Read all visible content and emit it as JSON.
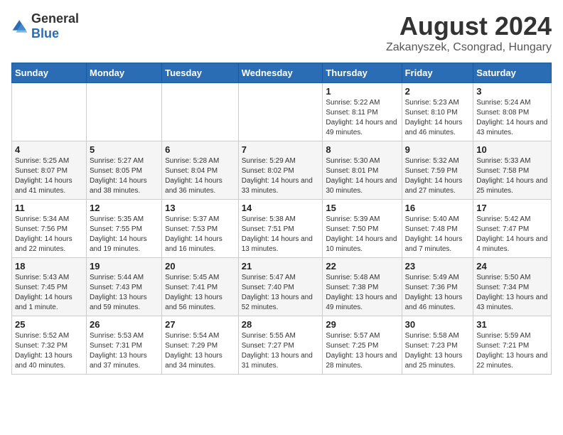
{
  "header": {
    "logo_general": "General",
    "logo_blue": "Blue",
    "title": "August 2024",
    "subtitle": "Zakanyszek, Csongrad, Hungary"
  },
  "days_of_week": [
    "Sunday",
    "Monday",
    "Tuesday",
    "Wednesday",
    "Thursday",
    "Friday",
    "Saturday"
  ],
  "weeks": [
    [
      {
        "day": "",
        "sunrise": "",
        "sunset": "",
        "daylight": ""
      },
      {
        "day": "",
        "sunrise": "",
        "sunset": "",
        "daylight": ""
      },
      {
        "day": "",
        "sunrise": "",
        "sunset": "",
        "daylight": ""
      },
      {
        "day": "",
        "sunrise": "",
        "sunset": "",
        "daylight": ""
      },
      {
        "day": "1",
        "sunrise": "5:22 AM",
        "sunset": "8:11 PM",
        "daylight": "14 hours and 49 minutes."
      },
      {
        "day": "2",
        "sunrise": "5:23 AM",
        "sunset": "8:10 PM",
        "daylight": "14 hours and 46 minutes."
      },
      {
        "day": "3",
        "sunrise": "5:24 AM",
        "sunset": "8:08 PM",
        "daylight": "14 hours and 43 minutes."
      }
    ],
    [
      {
        "day": "4",
        "sunrise": "5:25 AM",
        "sunset": "8:07 PM",
        "daylight": "14 hours and 41 minutes."
      },
      {
        "day": "5",
        "sunrise": "5:27 AM",
        "sunset": "8:05 PM",
        "daylight": "14 hours and 38 minutes."
      },
      {
        "day": "6",
        "sunrise": "5:28 AM",
        "sunset": "8:04 PM",
        "daylight": "14 hours and 36 minutes."
      },
      {
        "day": "7",
        "sunrise": "5:29 AM",
        "sunset": "8:02 PM",
        "daylight": "14 hours and 33 minutes."
      },
      {
        "day": "8",
        "sunrise": "5:30 AM",
        "sunset": "8:01 PM",
        "daylight": "14 hours and 30 minutes."
      },
      {
        "day": "9",
        "sunrise": "5:32 AM",
        "sunset": "7:59 PM",
        "daylight": "14 hours and 27 minutes."
      },
      {
        "day": "10",
        "sunrise": "5:33 AM",
        "sunset": "7:58 PM",
        "daylight": "14 hours and 25 minutes."
      }
    ],
    [
      {
        "day": "11",
        "sunrise": "5:34 AM",
        "sunset": "7:56 PM",
        "daylight": "14 hours and 22 minutes."
      },
      {
        "day": "12",
        "sunrise": "5:35 AM",
        "sunset": "7:55 PM",
        "daylight": "14 hours and 19 minutes."
      },
      {
        "day": "13",
        "sunrise": "5:37 AM",
        "sunset": "7:53 PM",
        "daylight": "14 hours and 16 minutes."
      },
      {
        "day": "14",
        "sunrise": "5:38 AM",
        "sunset": "7:51 PM",
        "daylight": "14 hours and 13 minutes."
      },
      {
        "day": "15",
        "sunrise": "5:39 AM",
        "sunset": "7:50 PM",
        "daylight": "14 hours and 10 minutes."
      },
      {
        "day": "16",
        "sunrise": "5:40 AM",
        "sunset": "7:48 PM",
        "daylight": "14 hours and 7 minutes."
      },
      {
        "day": "17",
        "sunrise": "5:42 AM",
        "sunset": "7:47 PM",
        "daylight": "14 hours and 4 minutes."
      }
    ],
    [
      {
        "day": "18",
        "sunrise": "5:43 AM",
        "sunset": "7:45 PM",
        "daylight": "14 hours and 1 minute."
      },
      {
        "day": "19",
        "sunrise": "5:44 AM",
        "sunset": "7:43 PM",
        "daylight": "13 hours and 59 minutes."
      },
      {
        "day": "20",
        "sunrise": "5:45 AM",
        "sunset": "7:41 PM",
        "daylight": "13 hours and 56 minutes."
      },
      {
        "day": "21",
        "sunrise": "5:47 AM",
        "sunset": "7:40 PM",
        "daylight": "13 hours and 52 minutes."
      },
      {
        "day": "22",
        "sunrise": "5:48 AM",
        "sunset": "7:38 PM",
        "daylight": "13 hours and 49 minutes."
      },
      {
        "day": "23",
        "sunrise": "5:49 AM",
        "sunset": "7:36 PM",
        "daylight": "13 hours and 46 minutes."
      },
      {
        "day": "24",
        "sunrise": "5:50 AM",
        "sunset": "7:34 PM",
        "daylight": "13 hours and 43 minutes."
      }
    ],
    [
      {
        "day": "25",
        "sunrise": "5:52 AM",
        "sunset": "7:32 PM",
        "daylight": "13 hours and 40 minutes."
      },
      {
        "day": "26",
        "sunrise": "5:53 AM",
        "sunset": "7:31 PM",
        "daylight": "13 hours and 37 minutes."
      },
      {
        "day": "27",
        "sunrise": "5:54 AM",
        "sunset": "7:29 PM",
        "daylight": "13 hours and 34 minutes."
      },
      {
        "day": "28",
        "sunrise": "5:55 AM",
        "sunset": "7:27 PM",
        "daylight": "13 hours and 31 minutes."
      },
      {
        "day": "29",
        "sunrise": "5:57 AM",
        "sunset": "7:25 PM",
        "daylight": "13 hours and 28 minutes."
      },
      {
        "day": "30",
        "sunrise": "5:58 AM",
        "sunset": "7:23 PM",
        "daylight": "13 hours and 25 minutes."
      },
      {
        "day": "31",
        "sunrise": "5:59 AM",
        "sunset": "7:21 PM",
        "daylight": "13 hours and 22 minutes."
      }
    ]
  ],
  "labels": {
    "sunrise": "Sunrise:",
    "sunset": "Sunset:",
    "daylight": "Daylight:"
  }
}
